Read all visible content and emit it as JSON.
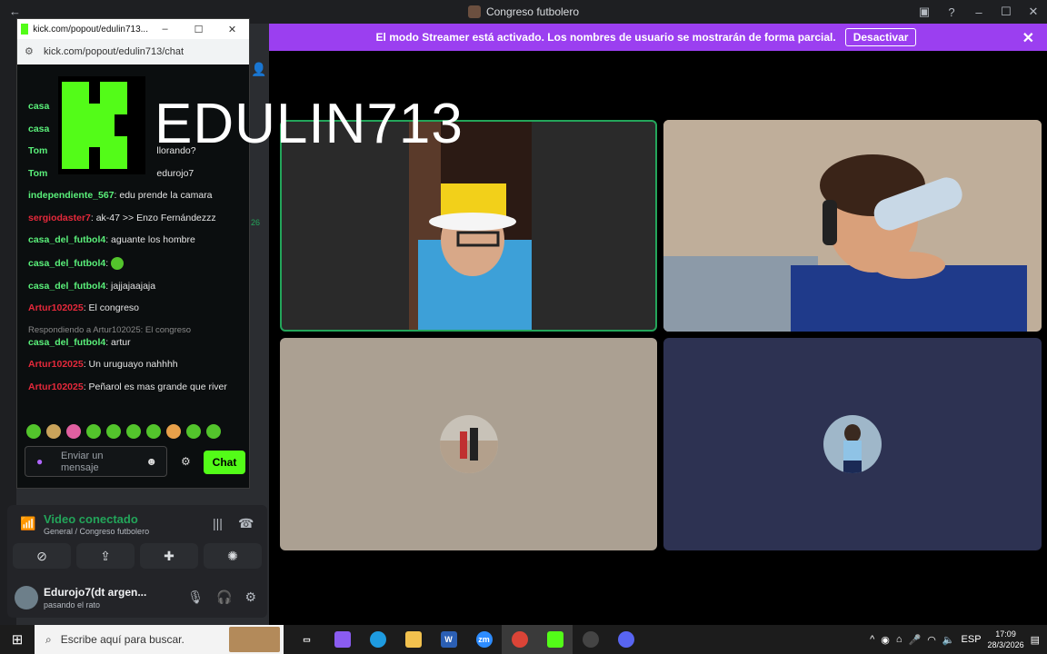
{
  "titlebar": {
    "title": "Congreso futbolero"
  },
  "banner": {
    "text": "El modo Streamer está activado. Los nombres de usuario se mostrarán de forma parcial.",
    "button": "Desactivar"
  },
  "kick_window": {
    "title": "kick.com/popout/edulin713...",
    "url": "kick.com/popout/edulin713/chat",
    "overlay_text": "EDULIN713",
    "messages": [
      {
        "user": "casa",
        "text": "",
        "color": "green"
      },
      {
        "user": "casa",
        "text": "",
        "color": "green"
      },
      {
        "user": "Tom",
        "text": "llorando?",
        "color": "green"
      },
      {
        "user": "Tom",
        "text": "edurojo7",
        "color": "green"
      },
      {
        "user": "independiente_567",
        "text": "edu prende la camara",
        "color": "green"
      },
      {
        "user": "sergiodaster7",
        "text": "ak-47 >> Enzo Fernándezzz",
        "color": "red"
      },
      {
        "user": "casa_del_futbol4",
        "text": "aguante los hombre",
        "color": "green"
      },
      {
        "user": "casa_del_futbol4",
        "text": "",
        "color": "green",
        "emote": true
      },
      {
        "user": "casa_del_futbol4",
        "text": "jajjajaajaja",
        "color": "green"
      },
      {
        "user": "Artur102025",
        "text": "El congreso",
        "color": "red"
      }
    ],
    "reply": "Respondiendo a Artur102025: El congreso",
    "messages2": [
      {
        "user": "casa_del_futbol4",
        "text": "artur",
        "color": "green"
      },
      {
        "user": "Artur102025",
        "text": "Un uruguayo nahhhh",
        "color": "red"
      },
      {
        "user": "Artur102025",
        "text": "Peñarol es mas grande que river",
        "color": "red"
      }
    ],
    "input_placeholder": "Enviar un mensaje",
    "chat_button": "Chat",
    "side_count": "26"
  },
  "voice": {
    "status": "Video conectado",
    "channel": "General / Congreso futbolero"
  },
  "user": {
    "name": "Edurojo7(dt argen...",
    "status": "pasando el rato"
  },
  "taskbar": {
    "search_placeholder": "Escribe aquí para buscar.",
    "lang": "ESP",
    "time": "17:09",
    "date": "28/3/2026"
  }
}
